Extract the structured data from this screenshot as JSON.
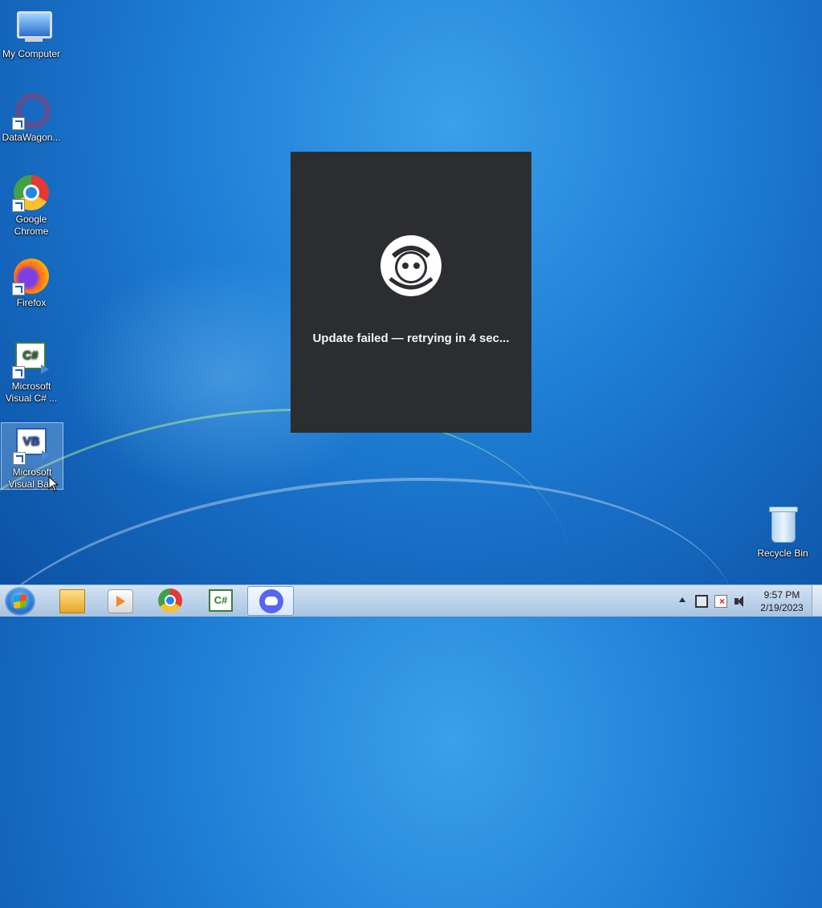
{
  "desktop": {
    "icons": [
      {
        "label": "My Computer",
        "icon": "computer-icon"
      },
      {
        "label": "DataWagon...",
        "icon": "datawagon-icon"
      },
      {
        "label": "Google Chrome",
        "icon": "chrome-icon"
      },
      {
        "label": "Firefox",
        "icon": "firefox-icon"
      },
      {
        "label": "Microsoft Visual C# ...",
        "icon": "visual-csharp-icon"
      },
      {
        "label": "Microsoft Visual Basi",
        "icon": "visual-basic-icon"
      },
      {
        "label": "Recycle Bin",
        "icon": "recycle-bin-icon"
      }
    ]
  },
  "dialog": {
    "app": "Discord",
    "message": "Update failed — retrying in 4 sec...",
    "background": "#2b2d31"
  },
  "taskbar": {
    "start_icon": "windows-start-icon",
    "pinned": [
      {
        "name": "Windows Explorer",
        "icon": "folder-icon"
      },
      {
        "name": "Windows Media Player",
        "icon": "media-player-icon"
      },
      {
        "name": "Google Chrome",
        "icon": "chrome-icon"
      },
      {
        "name": "Visual C#",
        "icon": "visual-csharp-icon",
        "text": "C#"
      },
      {
        "name": "Discord",
        "icon": "discord-icon",
        "active": true
      }
    ],
    "tray": {
      "time": "9:57 PM",
      "date": "2/19/2023"
    }
  },
  "vs_labels": {
    "csharp": "C#",
    "vb": "VB"
  }
}
